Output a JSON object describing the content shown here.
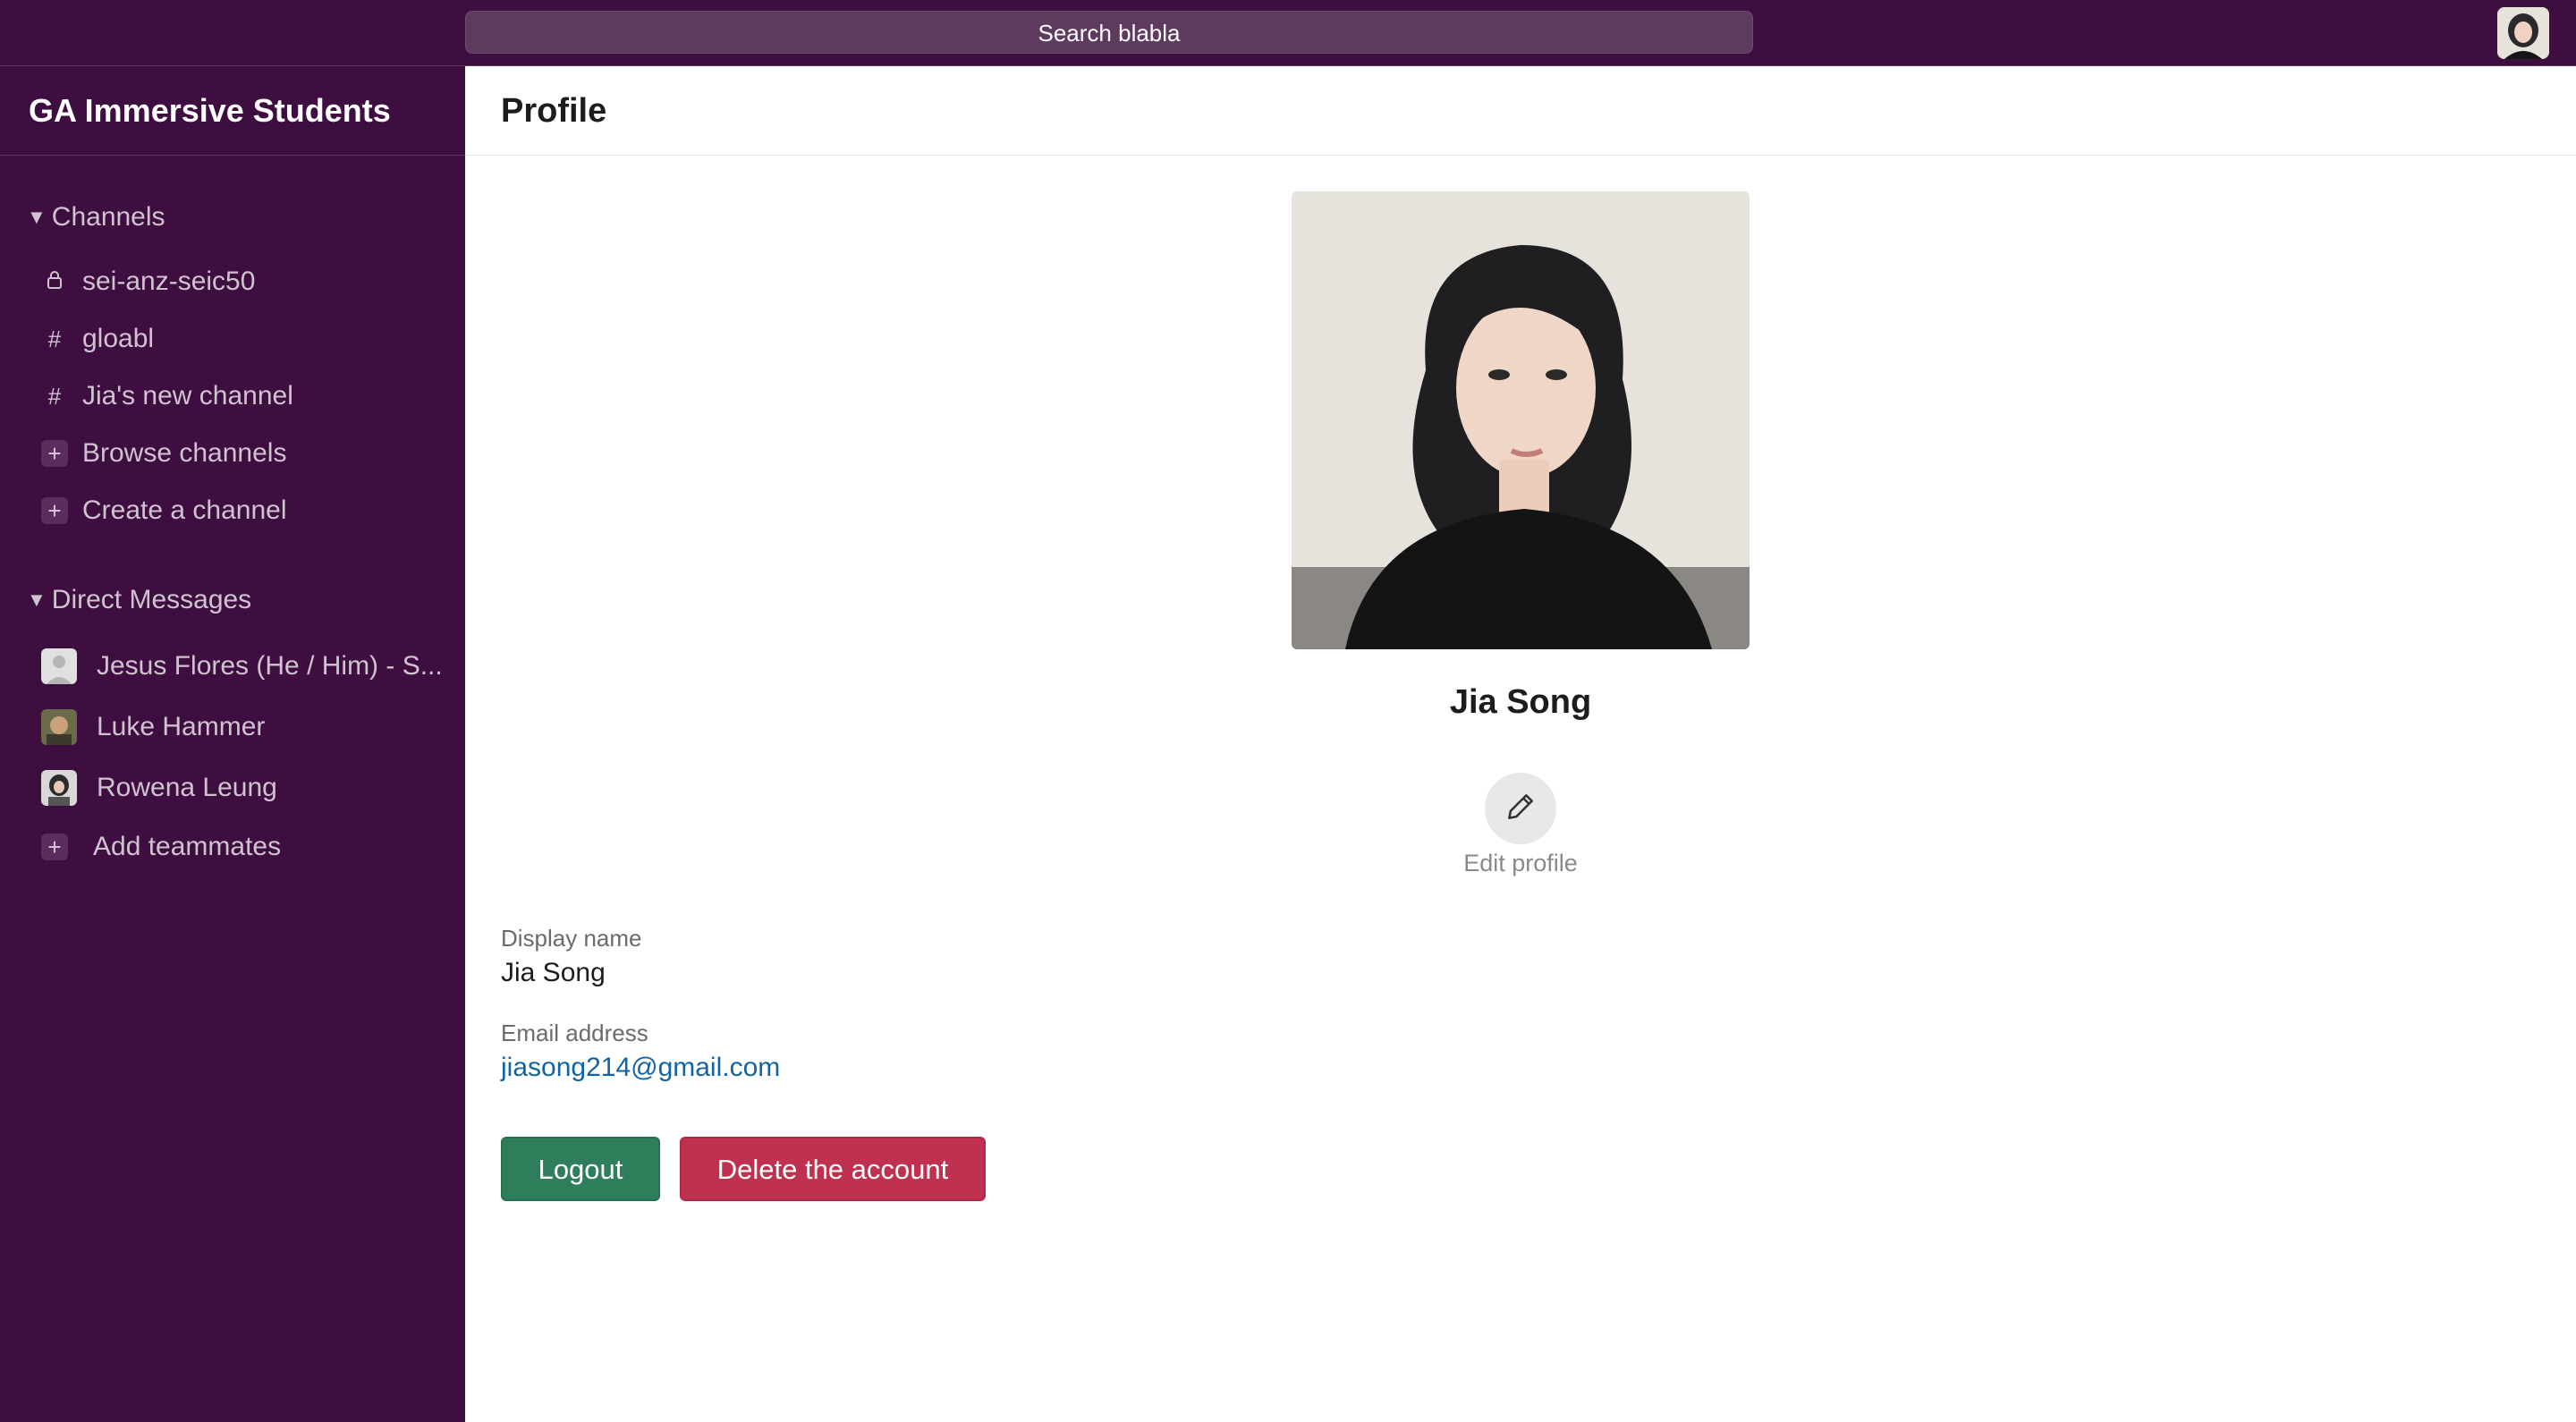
{
  "search": {
    "label": "Search blabla"
  },
  "workspace": {
    "name": "GA Immersive Students"
  },
  "sidebar": {
    "channels_heading": "Channels",
    "channels": [
      {
        "icon": "lock-icon",
        "label": "sei-anz-seic50"
      },
      {
        "icon": "hash-icon",
        "label": "gloabl"
      },
      {
        "icon": "hash-icon",
        "label": "Jia's new channel"
      }
    ],
    "browse_label": "Browse channels",
    "create_label": "Create a channel",
    "dm_heading": "Direct Messages",
    "dms": [
      {
        "label": "Jesus Flores (He / Him) - S..."
      },
      {
        "label": "Luke Hammer"
      },
      {
        "label": "Rowena Leung"
      }
    ],
    "add_teammates_label": "Add teammates"
  },
  "main": {
    "title": "Profile",
    "profile_name": "Jia Song",
    "edit_label": "Edit profile",
    "display_name_label": "Display name",
    "display_name_value": "Jia Song",
    "email_label": "Email address",
    "email_value": "jiasong214@gmail.com",
    "logout_label": "Logout",
    "delete_label": "Delete the account"
  },
  "colors": {
    "sidebar_bg": "#3f0e40",
    "logout_bg": "#2e7d5b",
    "delete_bg": "#c0314f",
    "link": "#1264a3"
  }
}
